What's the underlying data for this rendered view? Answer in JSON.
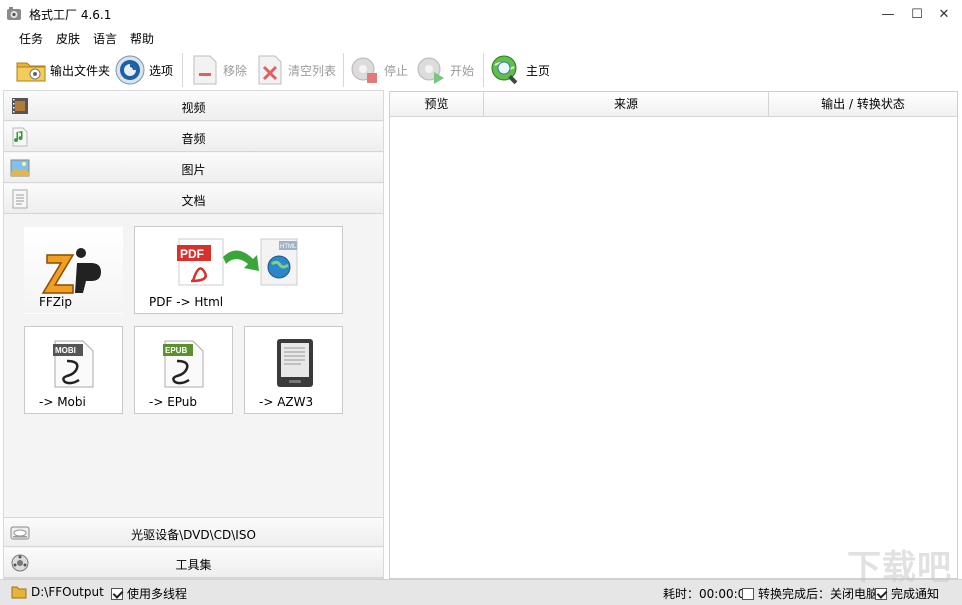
{
  "window": {
    "title": "格式工厂 4.6.1",
    "minimize": "—",
    "maximize": "☐",
    "close": "✕"
  },
  "menu": [
    "任务",
    "皮肤",
    "语言",
    "帮助"
  ],
  "toolbar": {
    "output_folder": "输出文件夹",
    "options": "选项",
    "remove": "移除",
    "clear_list": "清空列表",
    "stop": "停止",
    "start": "开始",
    "home": "主页"
  },
  "categories": {
    "video": "视频",
    "audio": "音频",
    "image": "图片",
    "document": "文档",
    "disc": "光驱设备\\DVD\\CD\\ISO",
    "tools": "工具集"
  },
  "tiles": {
    "ffzip": "FFZip",
    "pdf_html": "PDF -> Html",
    "mobi": "-> Mobi",
    "epub": "-> EPub",
    "azw3": "-> AZW3",
    "pdf_badge": "PDF",
    "html_badge": "HTML",
    "mobi_badge": "MOBI",
    "epub_badge": "EPUB"
  },
  "table": {
    "columns": [
      "预览",
      "来源",
      "输出 / 转换状态"
    ]
  },
  "status": {
    "output_path": "D:\\FFOutput",
    "multithread": "使用多线程",
    "multithread_checked": true,
    "elapsed": "耗时：00:00:00",
    "after_convert": "转换完成后：关闭电脑",
    "after_convert_checked": false,
    "notify": "完成通知",
    "notify_checked": true
  },
  "watermark": "下载吧",
  "colors": {
    "accent_green": "#3aa63a",
    "pdf_red": "#d9302c",
    "disabled_text": "#9a9a9a"
  }
}
